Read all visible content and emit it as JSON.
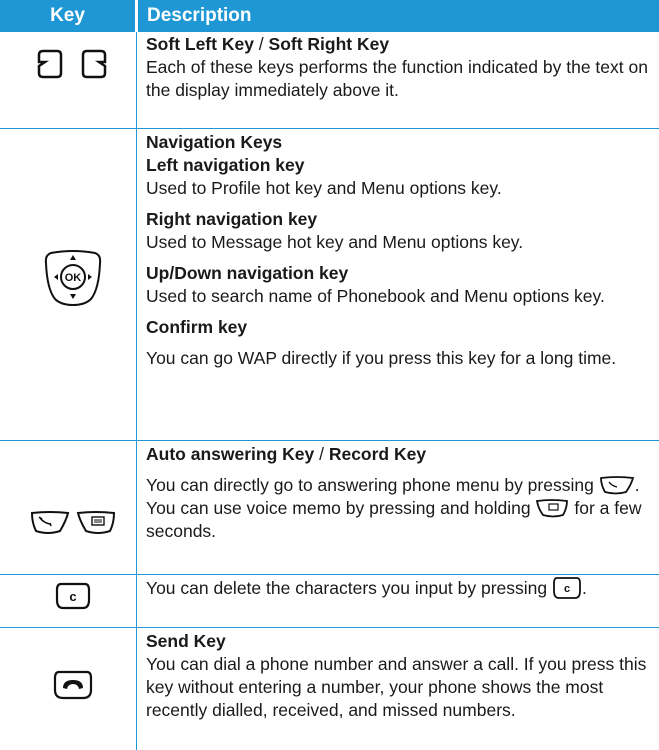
{
  "header": {
    "key": "Key",
    "description": "Description"
  },
  "soft": {
    "title_left": "Soft Left Key",
    "sep": " / ",
    "title_right": "Soft Right Key",
    "text": "Each of these keys performs the function indicated by the text on the display immediately above it."
  },
  "nav": {
    "title": "Navigation Keys",
    "left_title": "Left navigation key",
    "left_text": "Used to Profile hot key and Menu options key.",
    "right_title": "Right navigation key",
    "right_text": "Used to Message hot key and Menu options key.",
    "updown_title": "Up/Down navigation key",
    "updown_text": "Used to search name of Phonebook and Menu options key.",
    "confirm_title": "Confirm key",
    "confirm_text": "You can go WAP directly if you press this key for a long time.",
    "ok_label": "OK"
  },
  "auto": {
    "title_left": "Auto answering Key",
    "sep": " / ",
    "title_right": "Record Key",
    "text_a": "You can directly go to answering phone menu by pressing",
    "text_b": ". You can use voice memo by pressing and holding",
    "text_c": "for a few seconds."
  },
  "clear": {
    "text_a": "You can delete the characters you input by pressing",
    "text_b": ".",
    "key_label": "c"
  },
  "send": {
    "title": "Send Key",
    "text": "You can dial a phone number and answer a call. If you press this key without entering a number, your phone shows the most recently dialled, received, and missed numbers."
  },
  "colors": {
    "accent": "#1f97d4",
    "text": "#1a1a1a"
  }
}
